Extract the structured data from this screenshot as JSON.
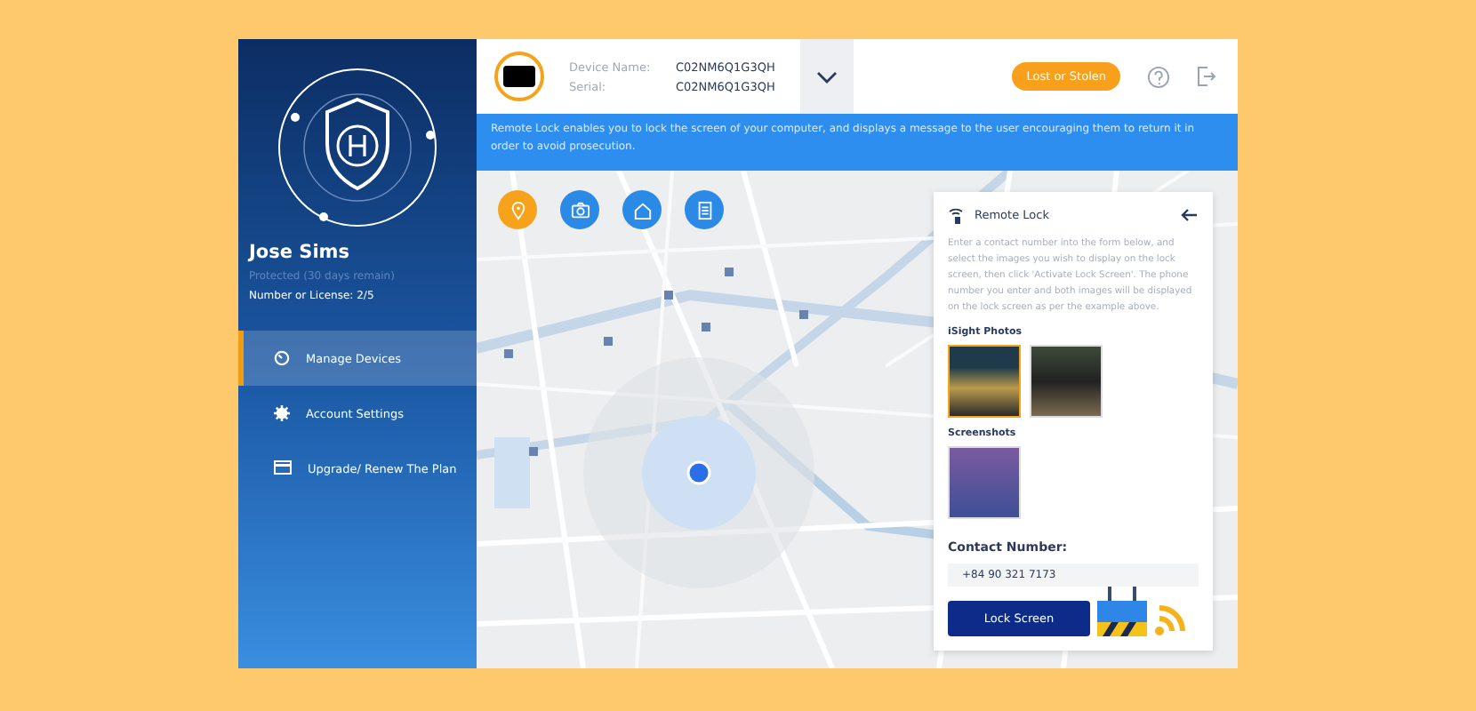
{
  "sidebar": {
    "user_name": "Jose Sims",
    "status": "Protected (30 days remain)",
    "license": "Number or License: 2/5",
    "items": [
      {
        "kind": "devices",
        "label": "Manage Devices",
        "selected": true
      },
      {
        "kind": "settings",
        "label": "Account Settings",
        "selected": false
      },
      {
        "kind": "upgrade",
        "label": "Upgrade/ Renew The Plan",
        "selected": false
      }
    ]
  },
  "header": {
    "device_name_label": "Device Name:",
    "device_name": "C02NM6Q1G3QH",
    "serial_label": "Serial:",
    "serial": "C02NM6Q1G3QH",
    "lost_button": "Lost or Stolen"
  },
  "banner": "Remote Lock enables you to lock the screen of your computer, and displays a message to the user encouraging them to return it in order to avoid prosecution.",
  "map_actions": [
    {
      "kind": "location",
      "selected": true
    },
    {
      "kind": "camera",
      "selected": false
    },
    {
      "kind": "home",
      "selected": false
    },
    {
      "kind": "document",
      "selected": false
    }
  ],
  "panel": {
    "title": "Remote Lock",
    "description": "Enter a contact number into the form below, and select the images you wish to display on the lock screen, then click 'Activate Lock Screen'. The phone number you enter and both images will be displayed on the lock screen as per the example above.",
    "isight_label": "iSight Photos",
    "isight_photos": [
      {
        "selected": true
      },
      {
        "selected": false
      }
    ],
    "screenshots_label": "Screenshots",
    "screenshots": [
      {
        "selected": false
      }
    ],
    "contact_label": "Contact Number:",
    "contact_value": "+84 90 321 7173",
    "lock_button": "Lock Screen"
  }
}
